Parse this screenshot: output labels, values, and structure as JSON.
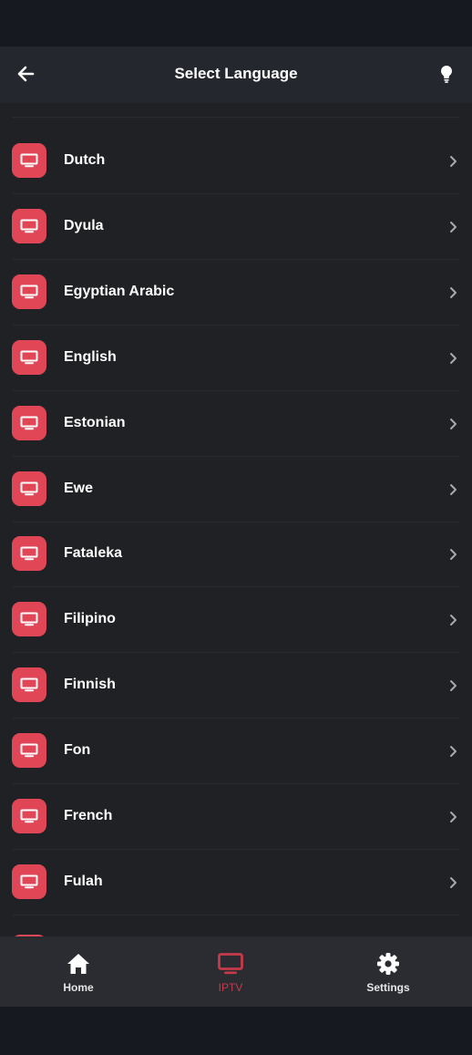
{
  "header": {
    "title": "Select Language",
    "back_icon": "arrow-left-icon",
    "action_icon": "lightbulb-icon"
  },
  "list": {
    "item_icon": "tv-icon",
    "items": [
      {
        "label": "Dutch"
      },
      {
        "label": "Dyula"
      },
      {
        "label": "Egyptian Arabic"
      },
      {
        "label": "English"
      },
      {
        "label": "Estonian"
      },
      {
        "label": "Ewe"
      },
      {
        "label": "Fataleka"
      },
      {
        "label": "Filipino"
      },
      {
        "label": "Finnish"
      },
      {
        "label": "Fon"
      },
      {
        "label": "French"
      },
      {
        "label": "Fulah"
      }
    ]
  },
  "bottom_nav": {
    "items": [
      {
        "label": "Home",
        "icon": "home-icon",
        "active": false
      },
      {
        "label": "IPTV",
        "icon": "tv-icon",
        "active": true
      },
      {
        "label": "Settings",
        "icon": "gear-icon",
        "active": false
      }
    ]
  },
  "colors": {
    "accent": "#e14656",
    "active_nav": "#c63a4a",
    "app_bar": "#24272d",
    "list_bg": "#1f2125",
    "nav_bg": "#2a2c31"
  }
}
